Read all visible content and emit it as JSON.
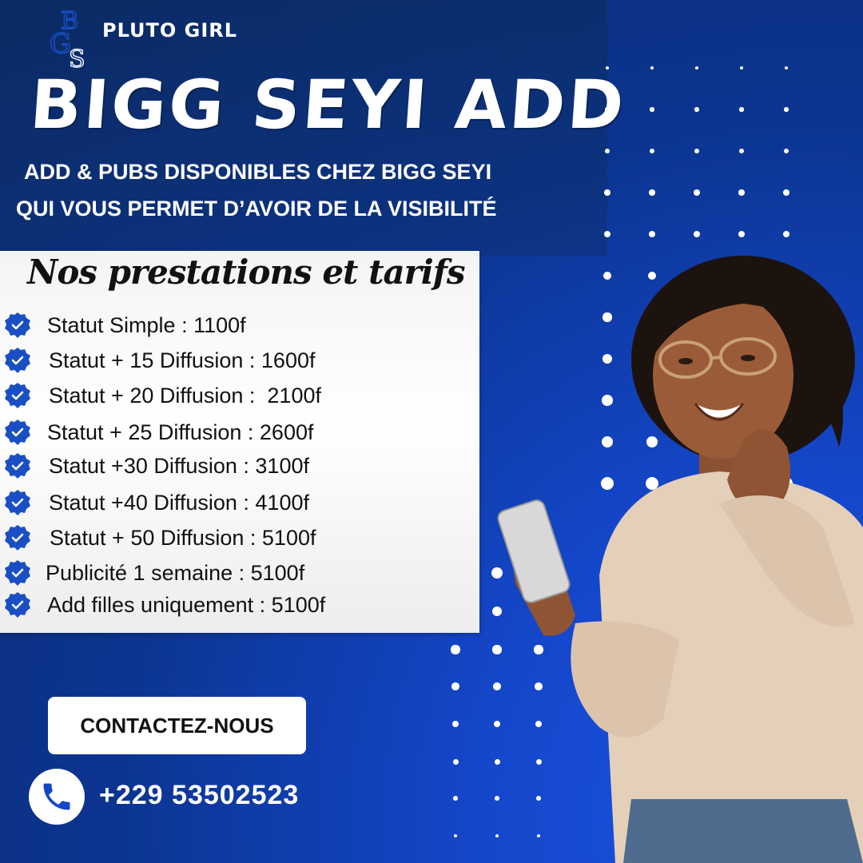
{
  "brand": {
    "logo_letters": "BGS",
    "name": "PLUTO GIRL"
  },
  "headline": "BIGG SEYI ADD",
  "subtitle": {
    "line1": "ADD & PUBS DISPONIBLES CHEZ BIGG SEYI",
    "line2": "QUI VOUS PERMET D’AVOIR DE LA VISIBILITÉ"
  },
  "services": {
    "title": "Nos prestations et tarifs",
    "items": [
      {
        "label": "Statut Simple : 1100f"
      },
      {
        "label": "Statut + 15 Diffusion : 1600f"
      },
      {
        "label": "Statut + 20 Diffusion :  2100f"
      },
      {
        "label": "Statut + 25 Diffusion : 2600f"
      },
      {
        "label": "Statut +30 Diffusion : 3100f"
      },
      {
        "label": "Statut +40 Diffusion : 4100f"
      },
      {
        "label": "Statut + 50 Diffusion : 5100f"
      },
      {
        "label": "Publicité 1 semaine : 5100f"
      },
      {
        "label": "Add filles uniquement : 5100f"
      }
    ]
  },
  "contact": {
    "button_label": "CONTACTEZ-NOUS",
    "phone": "+229 53502523"
  },
  "colors": {
    "accent_blue": "#1446c9",
    "dark_navy": "#0b2b5c",
    "check_blue": "#1a4fc4"
  }
}
